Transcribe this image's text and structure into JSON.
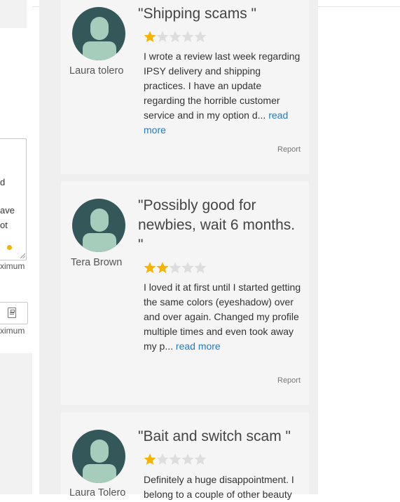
{
  "left_panel": {
    "frag_d": "d",
    "frag_ave": "ave",
    "frag_ot": "ot",
    "maximum_note_1": "ximum",
    "maximum_note_2": "ximum"
  },
  "colors": {
    "star_filled": "#f6b400",
    "star_empty": "#dddddd",
    "link": "#1f7cc8",
    "avatar_bg": "#34575a",
    "avatar_fg": "#a6cdbc"
  },
  "reviews": [
    {
      "reviewer": "Laura tolero",
      "title": "\"Shipping scams \"",
      "rating": 1,
      "rating_max": 5,
      "text": "I wrote a review last week regarding IPSY delivery and shipping practices. I have an update regarding the horrible customer service and in my option d...",
      "read_more": "read more",
      "report": "Report"
    },
    {
      "reviewer": "Tera Brown",
      "title": "\"Possibly good for newbies, wait 6 months. \"",
      "rating": 2,
      "rating_max": 5,
      "text": "I loved it at first until I started getting the same colors (eyeshadow) over and over again. Changed my profile multiple times and even took away my p...",
      "read_more": "read more",
      "report": "Report"
    },
    {
      "reviewer": "Laura Tolero",
      "title": "\"Bait and switch scam \"",
      "rating": 1,
      "rating_max": 5,
      "text": "Definitely a huge disappointment. I belong to a couple of other beauty",
      "read_more": "",
      "report": ""
    }
  ]
}
